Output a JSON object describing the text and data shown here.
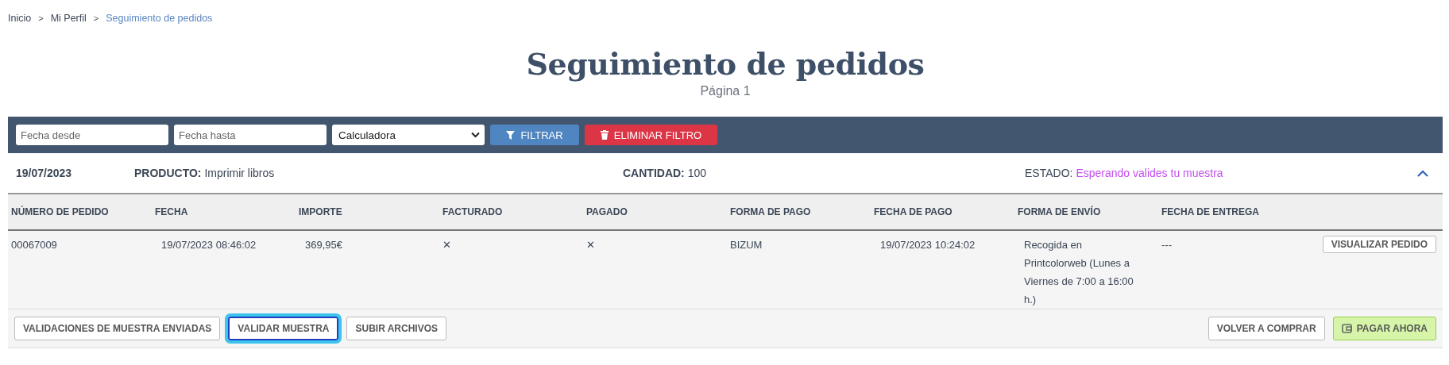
{
  "breadcrumb": [
    {
      "label": "Inicio",
      "current": false
    },
    {
      "label": "Mi Perfil",
      "current": false
    },
    {
      "label": "Seguimiento de pedidos",
      "current": true
    }
  ],
  "breadcrumb_separator": ">",
  "title": "Seguimiento de pedidos",
  "subtitle": "Página 1",
  "filters": {
    "date_from": {
      "placeholder": "Fecha desde"
    },
    "date_to": {
      "placeholder": "Fecha hasta"
    },
    "product_select": {
      "value": "Calculadora"
    },
    "filter_button": "FILTRAR",
    "clear_button": "ELIMINAR FILTRO"
  },
  "order": {
    "date": "19/07/2023",
    "product_label": "PRODUCTO:",
    "product": "Imprimir libros",
    "quantity_label": "CANTIDAD:",
    "quantity": "100",
    "status_label": "ESTADO:",
    "status": "Esperando valides tu muestra",
    "expanded": true,
    "columns": [
      "NÚMERO DE PEDIDO",
      "FECHA",
      "IMPORTE",
      "FACTURADO",
      "PAGADO",
      "FORMA DE PAGO",
      "FECHA DE PAGO",
      "FORMA DE ENVÍO",
      "FECHA DE ENTREGA"
    ],
    "row": {
      "cells": [
        "00067009",
        "19/07/2023 08:46:02",
        "369,95€",
        "✕",
        "✕",
        "BIZUM",
        "19/07/2023 10:24:02",
        "Recogida en Printcolorweb (Lunes a Viernes de 7:00 a 16:00 h.)",
        "---"
      ],
      "view_button": "VISUALIZAR PEDIDO"
    },
    "actions_left": [
      {
        "label": "VALIDACIONES DE MUESTRA ENVIADAS",
        "focused": false
      },
      {
        "label": "VALIDAR MUESTRA",
        "focused": true
      },
      {
        "label": "SUBIR ARCHIVOS",
        "focused": false
      }
    ],
    "actions_right": [
      {
        "label": "VOLVER A COMPRAR",
        "kind": "plain"
      },
      {
        "label": "PAGAR AHORA",
        "kind": "pay"
      }
    ]
  }
}
